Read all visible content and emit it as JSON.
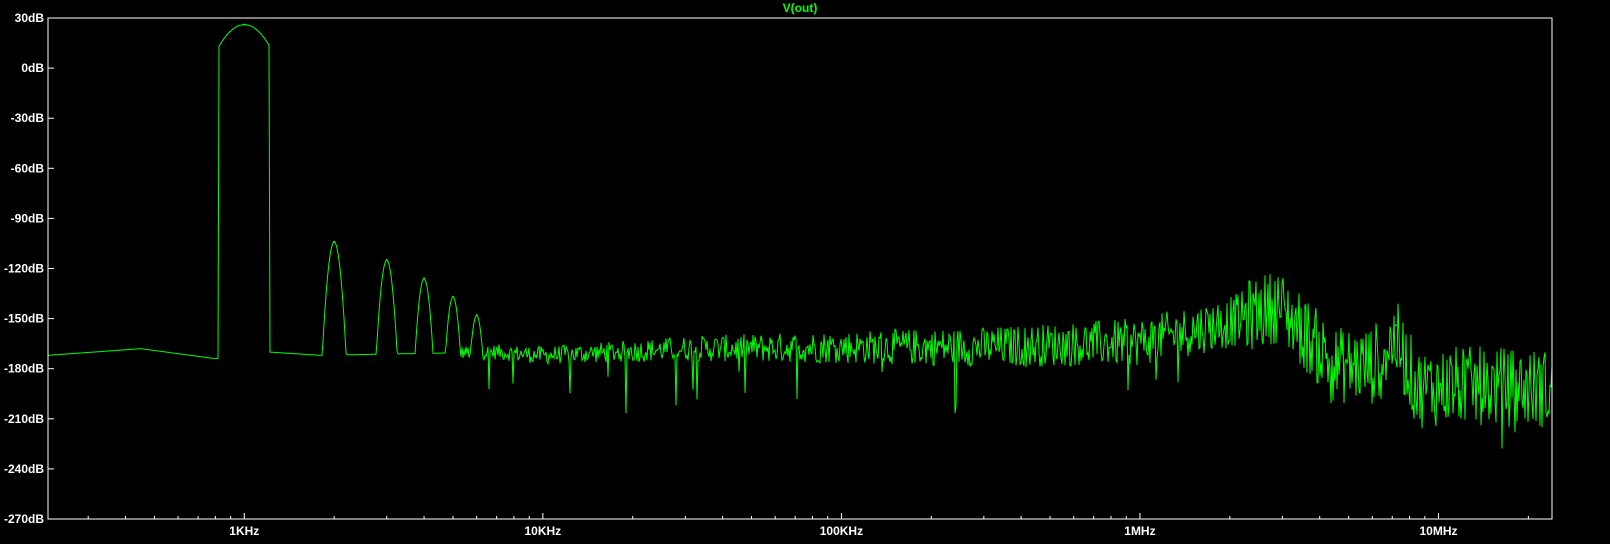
{
  "chart_data": {
    "type": "line",
    "title": "V(out)",
    "xlabel": "",
    "ylabel": "",
    "x_scale": "log",
    "xlim_hz": [
      220,
      24000000
    ],
    "ylim_db": [
      -270,
      30
    ],
    "x_ticks": [
      {
        "value": 1000,
        "label": "1KHz"
      },
      {
        "value": 10000,
        "label": "10KHz"
      },
      {
        "value": 100000,
        "label": "100KHz"
      },
      {
        "value": 1000000,
        "label": "1MHz"
      },
      {
        "value": 10000000,
        "label": "10MHz"
      }
    ],
    "y_ticks": [
      {
        "value": 30,
        "label": "30dB"
      },
      {
        "value": 0,
        "label": "0dB"
      },
      {
        "value": -30,
        "label": "-30dB"
      },
      {
        "value": -60,
        "label": "-60dB"
      },
      {
        "value": -90,
        "label": "-90dB"
      },
      {
        "value": -120,
        "label": "-120dB"
      },
      {
        "value": -150,
        "label": "-150dB"
      },
      {
        "value": -180,
        "label": "-180dB"
      },
      {
        "value": -210,
        "label": "-210dB"
      },
      {
        "value": -240,
        "label": "-240dB"
      },
      {
        "value": -270,
        "label": "-270dB"
      }
    ],
    "grid": false,
    "colors": {
      "background": "#000000",
      "axes": "#ffffff",
      "trace": "#00ff00",
      "title": "#00ff00",
      "text": "#ffffff"
    },
    "series": [
      {
        "name": "V(out)",
        "peaks": [
          {
            "freq_hz": 1000,
            "db": 26
          },
          {
            "freq_hz": 2000,
            "db": -104
          },
          {
            "freq_hz": 3000,
            "db": -115
          },
          {
            "freq_hz": 4000,
            "db": -126
          },
          {
            "freq_hz": 5000,
            "db": -137
          },
          {
            "freq_hz": 6000,
            "db": -148
          },
          {
            "freq_hz": 2900000,
            "db": -137
          },
          {
            "freq_hz": 7200000,
            "db": -154
          }
        ],
        "floor_points": [
          {
            "freq_hz": 220,
            "db": -172
          },
          {
            "freq_hz": 450,
            "db": -168
          },
          {
            "freq_hz": 800,
            "db": -174
          },
          {
            "freq_hz": 1200,
            "db": -170
          },
          {
            "freq_hz": 1800,
            "db": -172
          },
          {
            "freq_hz": 7000,
            "db": -170
          },
          {
            "freq_hz": 10000,
            "db": -172
          },
          {
            "freq_hz": 30000,
            "db": -168
          },
          {
            "freq_hz": 100000,
            "db": -167
          },
          {
            "freq_hz": 300000,
            "db": -167
          },
          {
            "freq_hz": 1000000,
            "db": -164
          },
          {
            "freq_hz": 2000000,
            "db": -152
          },
          {
            "freq_hz": 2900000,
            "db": -142
          },
          {
            "freq_hz": 4500000,
            "db": -178
          },
          {
            "freq_hz": 6000000,
            "db": -178
          },
          {
            "freq_hz": 7200000,
            "db": -162
          },
          {
            "freq_hz": 8500000,
            "db": -192
          },
          {
            "freq_hz": 11000000,
            "db": -190
          },
          {
            "freq_hz": 24000000,
            "db": -192
          }
        ]
      }
    ]
  }
}
